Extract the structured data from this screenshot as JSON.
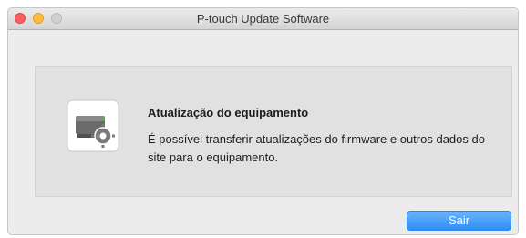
{
  "window": {
    "title": "P-touch Update Software"
  },
  "panel": {
    "title": "Atualização do equipamento",
    "description": "É possível transferir atualizações do firmware e outros dados do site para o equipamento.",
    "icon": "device-update-icon"
  },
  "buttons": {
    "exit_label": "Sair"
  },
  "colors": {
    "close": "#fc605c",
    "minimize": "#fdbc40",
    "zoom": "#d0d0d0",
    "accent": "#2d8ef4"
  }
}
